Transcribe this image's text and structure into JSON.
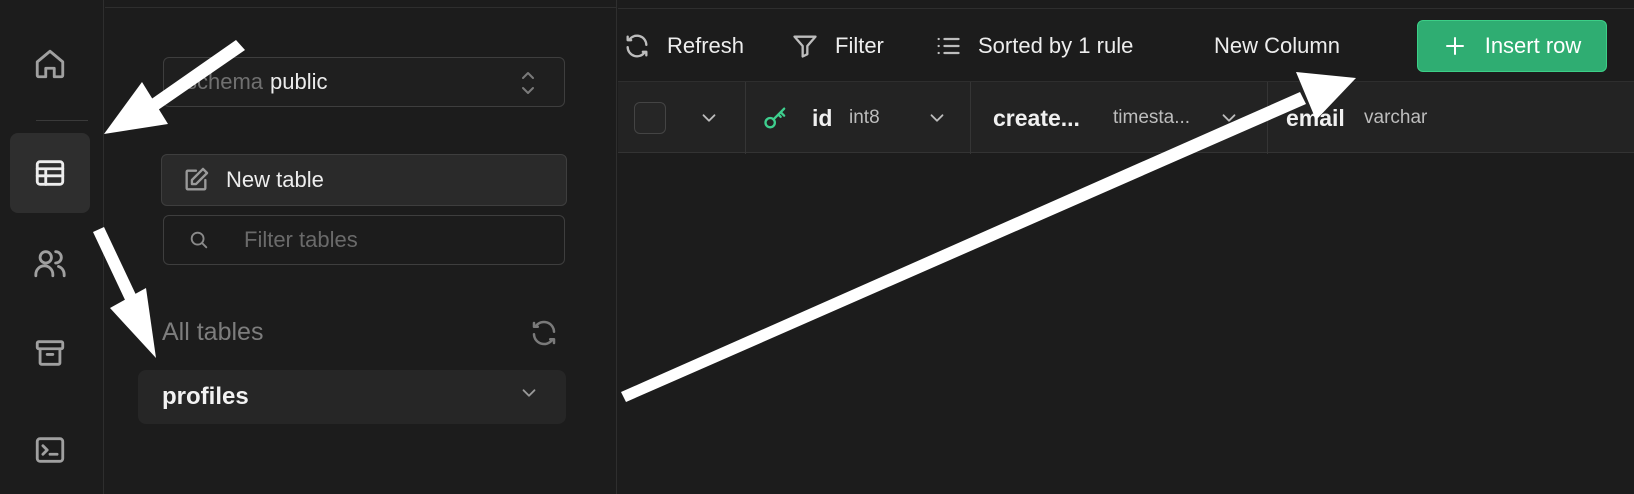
{
  "rail": {
    "icons": [
      "home-icon",
      "table-editor-icon",
      "users-icon",
      "archive-icon",
      "terminal-icon"
    ],
    "active": "table-editor-icon"
  },
  "sidebar": {
    "schema_label": "schema",
    "schema_value": "public",
    "new_table_label": "New table",
    "filter_placeholder": "Filter tables",
    "all_tables_label": "All tables",
    "tables": [
      {
        "name": "profiles"
      }
    ]
  },
  "toolbar": {
    "refresh_label": "Refresh",
    "filter_label": "Filter",
    "sort_label": "Sorted by 1 rule",
    "new_column_label": "New Column",
    "insert_row_label": "Insert row"
  },
  "grid": {
    "columns": [
      {
        "name": "id",
        "type": "int8",
        "primary_key": true
      },
      {
        "name": "create...",
        "type": "timesta..."
      },
      {
        "name": "email",
        "type": "varchar"
      }
    ]
  },
  "colors": {
    "accent": "#3ecf8e",
    "background": "#1c1c1c",
    "annotation_arrows": "#ffffff"
  }
}
